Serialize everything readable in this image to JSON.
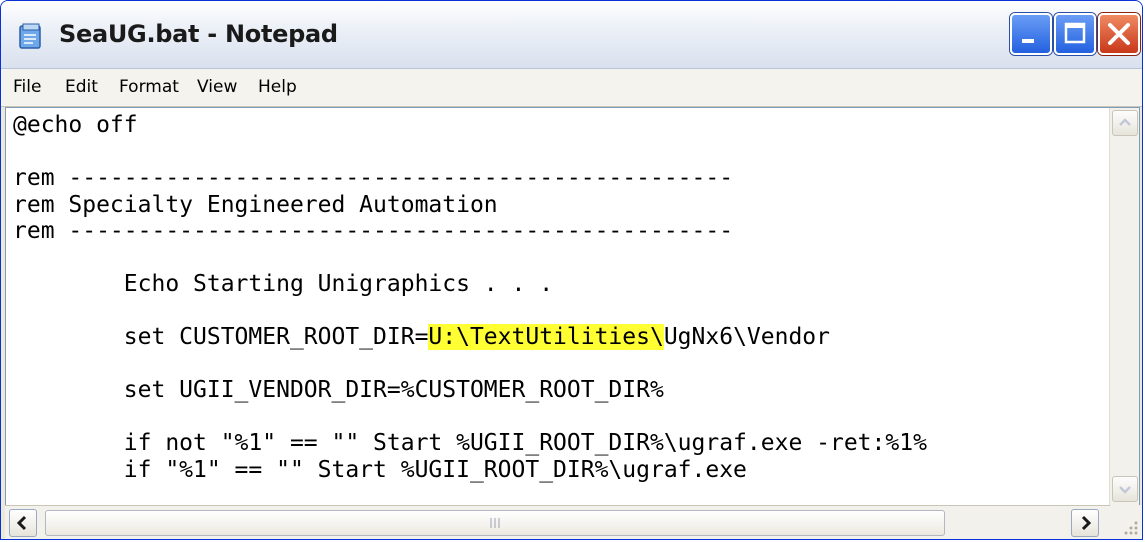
{
  "window": {
    "title": "SeaUG.bat - Notepad"
  },
  "menu": [
    "File",
    "Edit",
    "Format",
    "View",
    "Help"
  ],
  "editor": {
    "lines": [
      "@echo off",
      "",
      "rem ------------------------------------------------",
      "rem Specialty Engineered Automation",
      "rem ------------------------------------------------",
      "",
      "        Echo Starting Unigraphics . . .",
      "",
      "        set CUSTOMER_ROOT_DIR=",
      "",
      "        set UGII_VENDOR_DIR=%CUSTOMER_ROOT_DIR%",
      "",
      "        if not \"%1\" == \"\" Start %UGII_ROOT_DIR%\\ugraf.exe -ret:%1%",
      "        if \"%1\" == \"\" Start %UGII_ROOT_DIR%\\ugraf.exe"
    ],
    "highlighted": "U:\\TextUtilities\\",
    "after_highlight": "UgNx6\\Vendor",
    "highlight_color": "#ffff33"
  },
  "icons": {
    "app": "notepad-icon",
    "minimize": "minimize-icon",
    "maximize": "maximize-icon",
    "close": "close-icon"
  },
  "colors": {
    "titlebar_top": "#ffffff",
    "close_button": "#c8381a",
    "window_border": "#0831d9"
  }
}
